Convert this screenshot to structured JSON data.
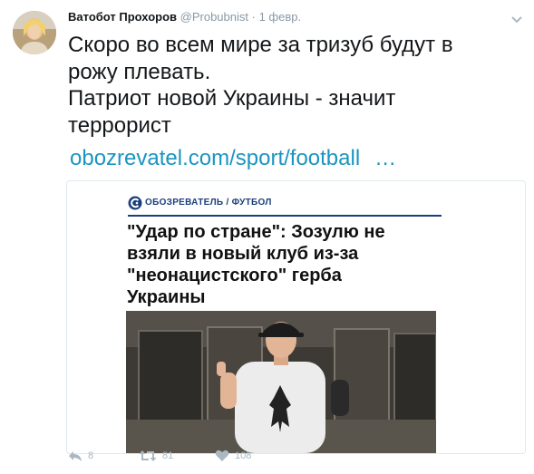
{
  "tweet": {
    "author_name": "Ватобот Прохоров",
    "author_handle": "@Probubnist",
    "separator": "·",
    "time": "1 февр.",
    "text_lines": [
      "Скоро во всем мире за тризуб будут в",
      "рожу плевать.",
      "Патриот новой Украины - значит",
      "террорист"
    ],
    "link": "obozrevatel.com/sport/football",
    "link_ellipsis": "…"
  },
  "card": {
    "source": "ОБОЗРЕВАТЕЛЬ / ФУТБОЛ",
    "headline_lines": [
      "\"Удар по стране\": Зозулю не",
      "взяли в новый клуб из-за",
      "\"неонацистского\" герба",
      "Украины"
    ]
  },
  "actions": {
    "reply_count": "8",
    "retweet_count": "81",
    "like_count": "108"
  },
  "colors": {
    "link": "#1b95c0",
    "muted": "#8899a6",
    "source_blue": "#1b3f7c"
  }
}
